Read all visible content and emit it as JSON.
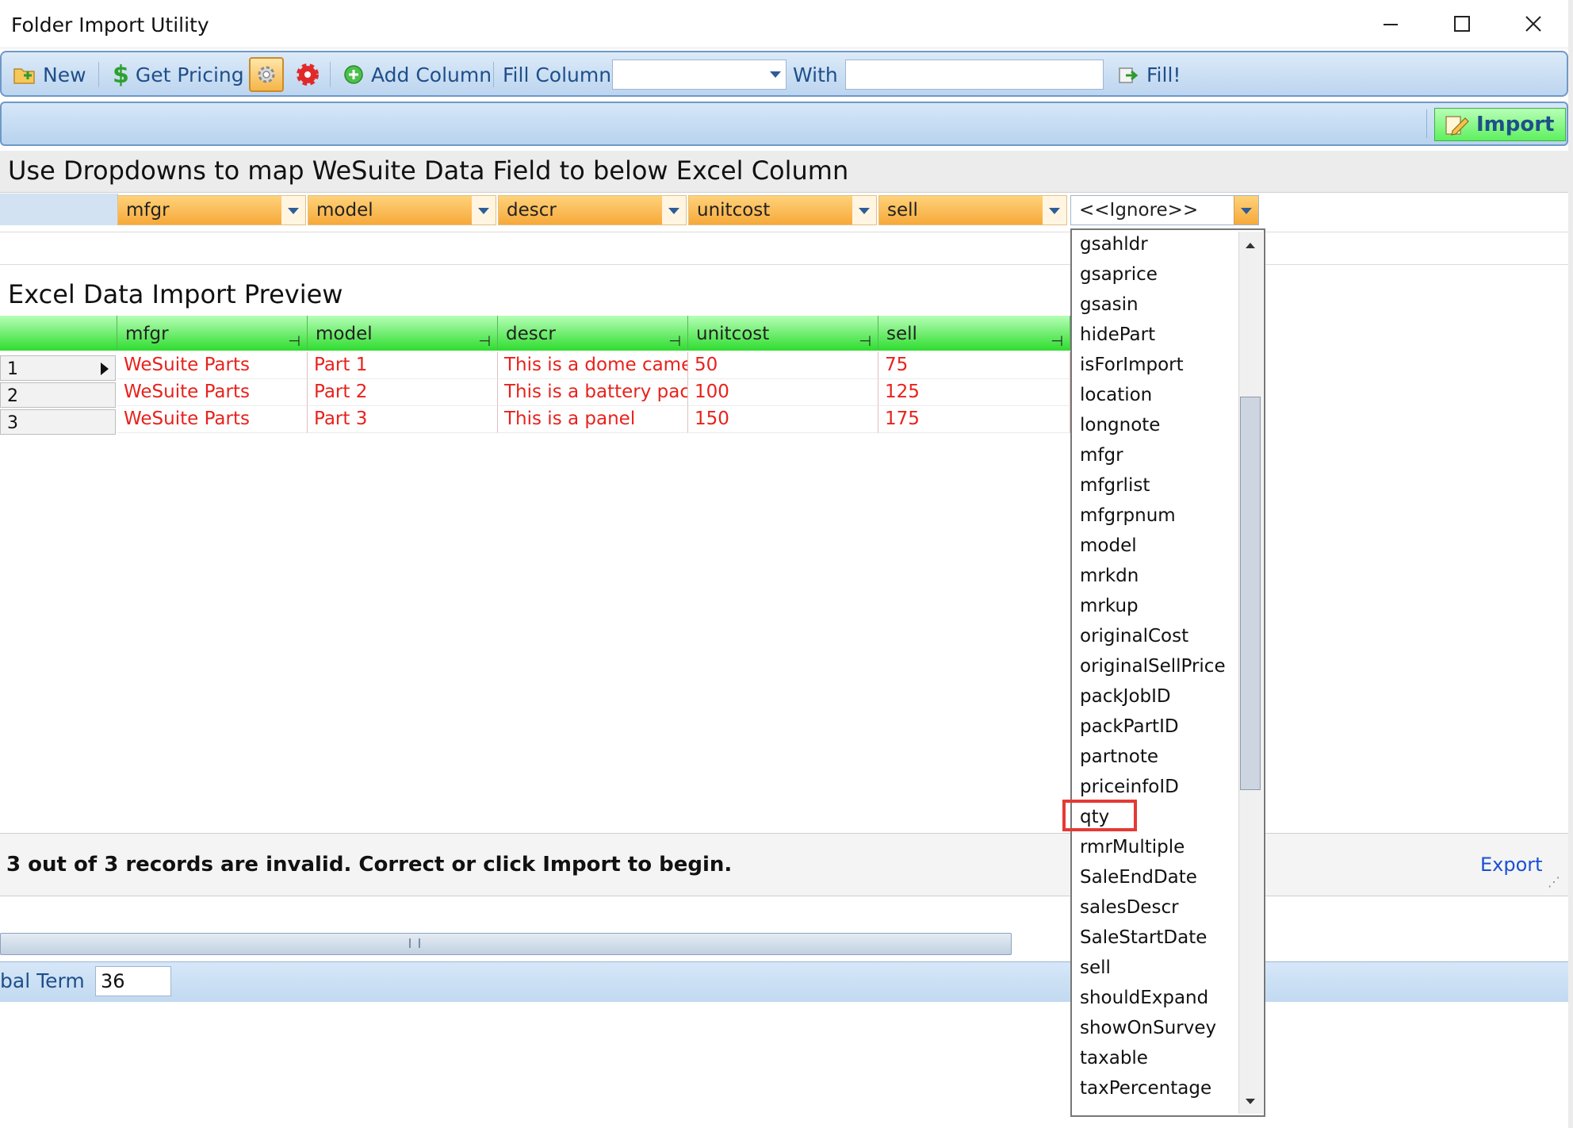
{
  "window": {
    "title": "Folder Import Utility"
  },
  "toolbar": {
    "new_label": "New",
    "get_pricing_label": "Get Pricing",
    "add_column_label": "Add Column",
    "fill_column_label": "Fill Column",
    "fill_column_value": "",
    "with_label": "With",
    "with_value": "",
    "fill_label": "Fill!"
  },
  "import_bar": {
    "import_label": "Import"
  },
  "mapping": {
    "title": "Use Dropdowns to map WeSuite Data Field to below Excel Column",
    "fields": [
      "mfgr",
      "model",
      "descr",
      "unitcost",
      "sell",
      "<<Ignore>>"
    ]
  },
  "preview": {
    "title": "Excel Data Import Preview",
    "columns": [
      "mfgr",
      "model",
      "descr",
      "unitcost",
      "sell"
    ],
    "rows": [
      {
        "num": "1",
        "cells": [
          "WeSuite Parts",
          "Part 1",
          "This is a dome came...",
          "50",
          "75"
        ]
      },
      {
        "num": "2",
        "cells": [
          "WeSuite Parts",
          "Part 2",
          "This is a battery pack",
          "100",
          "125"
        ]
      },
      {
        "num": "3",
        "cells": [
          "WeSuite Parts",
          "Part 3",
          "This is a panel",
          "150",
          "175"
        ]
      }
    ]
  },
  "status": {
    "message": "3 out of 3 records are invalid. Correct or click Import to begin.",
    "export_label": "Export"
  },
  "bottom": {
    "term_label": "bal Term",
    "term_value": "36"
  },
  "dropdown": {
    "items": [
      "gsahldr",
      "gsaprice",
      "gsasin",
      "hidePart",
      "isForImport",
      "location",
      "longnote",
      "mfgr",
      "mfgrlist",
      "mfgrpnum",
      "model",
      "mrkdn",
      "mrkup",
      "originalCost",
      "originalSellPrice",
      "packJobID",
      "packPartID",
      "partnote",
      "priceinfoID",
      "qty",
      "rmrMultiple",
      "SaleEndDate",
      "salesDescr",
      "SaleStartDate",
      "sell",
      "shouldExpand",
      "showOnSurvey",
      "taxable",
      "taxPercentage"
    ],
    "highlighted": "qty"
  },
  "colors": {
    "invalid_text": "#e8221c",
    "header_green": "#2fdc2f",
    "mapping_orange": "#f6a93a",
    "toolbar_blue": "#bcd5ef",
    "highlight_red": "#e53935",
    "link_blue": "#1a4fd6"
  }
}
